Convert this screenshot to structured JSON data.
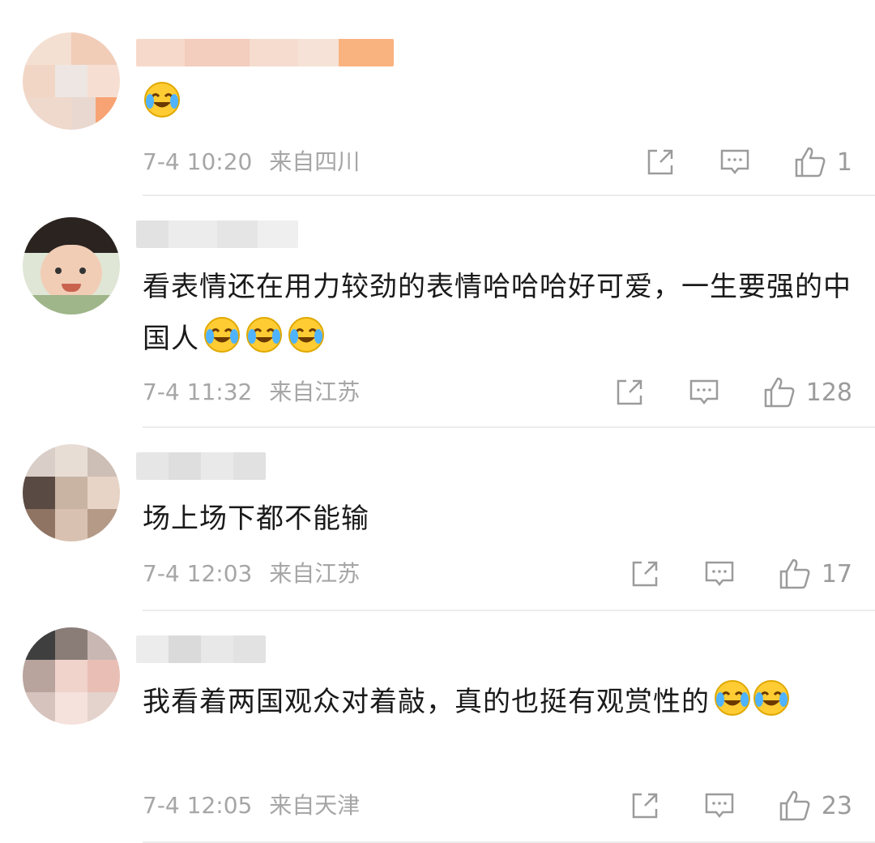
{
  "comments": [
    {
      "text": "",
      "time": "7-4 10:20",
      "location": "来自四川",
      "likes": "1",
      "emoji_icon": "laughing-crying-emoji",
      "avatar_colors": [
        "#f4d9c9",
        "#f2c8b0",
        "#ede7e3",
        "#f6e3d6",
        "#f7b087",
        "#e9d8cf"
      ]
    },
    {
      "text": "看表情还在用力较劲的表情哈哈哈好可爱，一生要强的中国人",
      "time": "7-4 11:32",
      "location": "来自江苏",
      "likes": "128",
      "emoji_icon": "laughing-crying-emoji",
      "avatar_colors": [
        "#222222",
        "#3a2c26",
        "#f1cdb6",
        "#e7b79c",
        "#7a5a45",
        "#b9c9a8"
      ]
    },
    {
      "text": "场上场下都不能输",
      "time": "7-4 12:03",
      "location": "来自江苏",
      "likes": "17",
      "avatar_colors": [
        "#5a4a44",
        "#c9b3a3",
        "#e7d4c6",
        "#8f7363",
        "#d8c1b0",
        "#b49a87"
      ]
    },
    {
      "text": "我看着两国观众对着敲，真的也挺有观赏性的",
      "time": "7-4 12:05",
      "location": "来自天津",
      "likes": "23",
      "emoji_icon": "laughing-crying-emoji",
      "avatar_colors": [
        "#3f3f3f",
        "#8a7d78",
        "#f0d3cb",
        "#e9bfb5",
        "#c8b7b2",
        "#f5e2dc"
      ]
    }
  ],
  "colors": {
    "text": "#1a1a1a",
    "meta": "#a6a6a6",
    "icon": "#9b9b9b",
    "divider": "#ececec",
    "emoji_face": "#ffcc33"
  }
}
